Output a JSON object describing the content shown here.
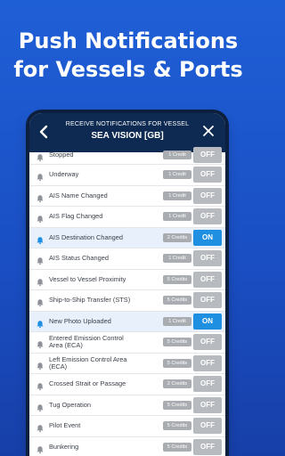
{
  "headline": {
    "line1": "Push Notifications",
    "line2": "for Vessels & Ports"
  },
  "appbar": {
    "subtitle": "RECEIVE NOTIFICATIONS FOR VESSEL",
    "title": "SEA VISION [GB]",
    "back_icon": "chevron-left-icon",
    "close_icon": "close-icon"
  },
  "colors": {
    "background": "#1f5fd6",
    "appbar": "#0e2a52",
    "toggle_on": "#1e8fe1",
    "toggle_off": "#b7babf",
    "credit_badge": "#a9acb1",
    "bell_on": "#1e8fe1",
    "bell_off": "#8e9298"
  },
  "notifications": [
    {
      "label": "Stopped",
      "credit": "1 Credit",
      "toggle": "OFF",
      "on": false
    },
    {
      "label": "Underway",
      "credit": "1 Credit",
      "toggle": "OFF",
      "on": false
    },
    {
      "label": "AIS Name Changed",
      "credit": "1 Credit",
      "toggle": "OFF",
      "on": false
    },
    {
      "label": "AIS Flag Changed",
      "credit": "1 Credit",
      "toggle": "OFF",
      "on": false
    },
    {
      "label": "AIS Destination Changed",
      "credit": "2 Credits",
      "toggle": "ON",
      "on": true
    },
    {
      "label": "AIS Status Changed",
      "credit": "1 Credit",
      "toggle": "OFF",
      "on": false
    },
    {
      "label": "Vessel to Vessel Proximity",
      "credit": "5 Credits",
      "toggle": "OFF",
      "on": false
    },
    {
      "label": "Ship-to-Ship Transfer (STS)",
      "credit": "5 Credits",
      "toggle": "OFF",
      "on": false
    },
    {
      "label": "New Photo Uploaded",
      "credit": "1 Credit",
      "toggle": "ON",
      "on": true
    },
    {
      "label": "Entered Emission Control Area (ECA)",
      "credit": "5 Credits",
      "toggle": "OFF",
      "on": false
    },
    {
      "label": "Left Emission Control Area (ECA)",
      "credit": "5 Credits",
      "toggle": "OFF",
      "on": false
    },
    {
      "label": "Crossed Strait or Passage",
      "credit": "2 Credits",
      "toggle": "OFF",
      "on": false
    },
    {
      "label": "Tug Operation",
      "credit": "5 Credits",
      "toggle": "OFF",
      "on": false
    },
    {
      "label": "Pilot Event",
      "credit": "5 Credits",
      "toggle": "OFF",
      "on": false
    },
    {
      "label": "Bunkering",
      "credit": "5 Credits",
      "toggle": "OFF",
      "on": false
    }
  ]
}
